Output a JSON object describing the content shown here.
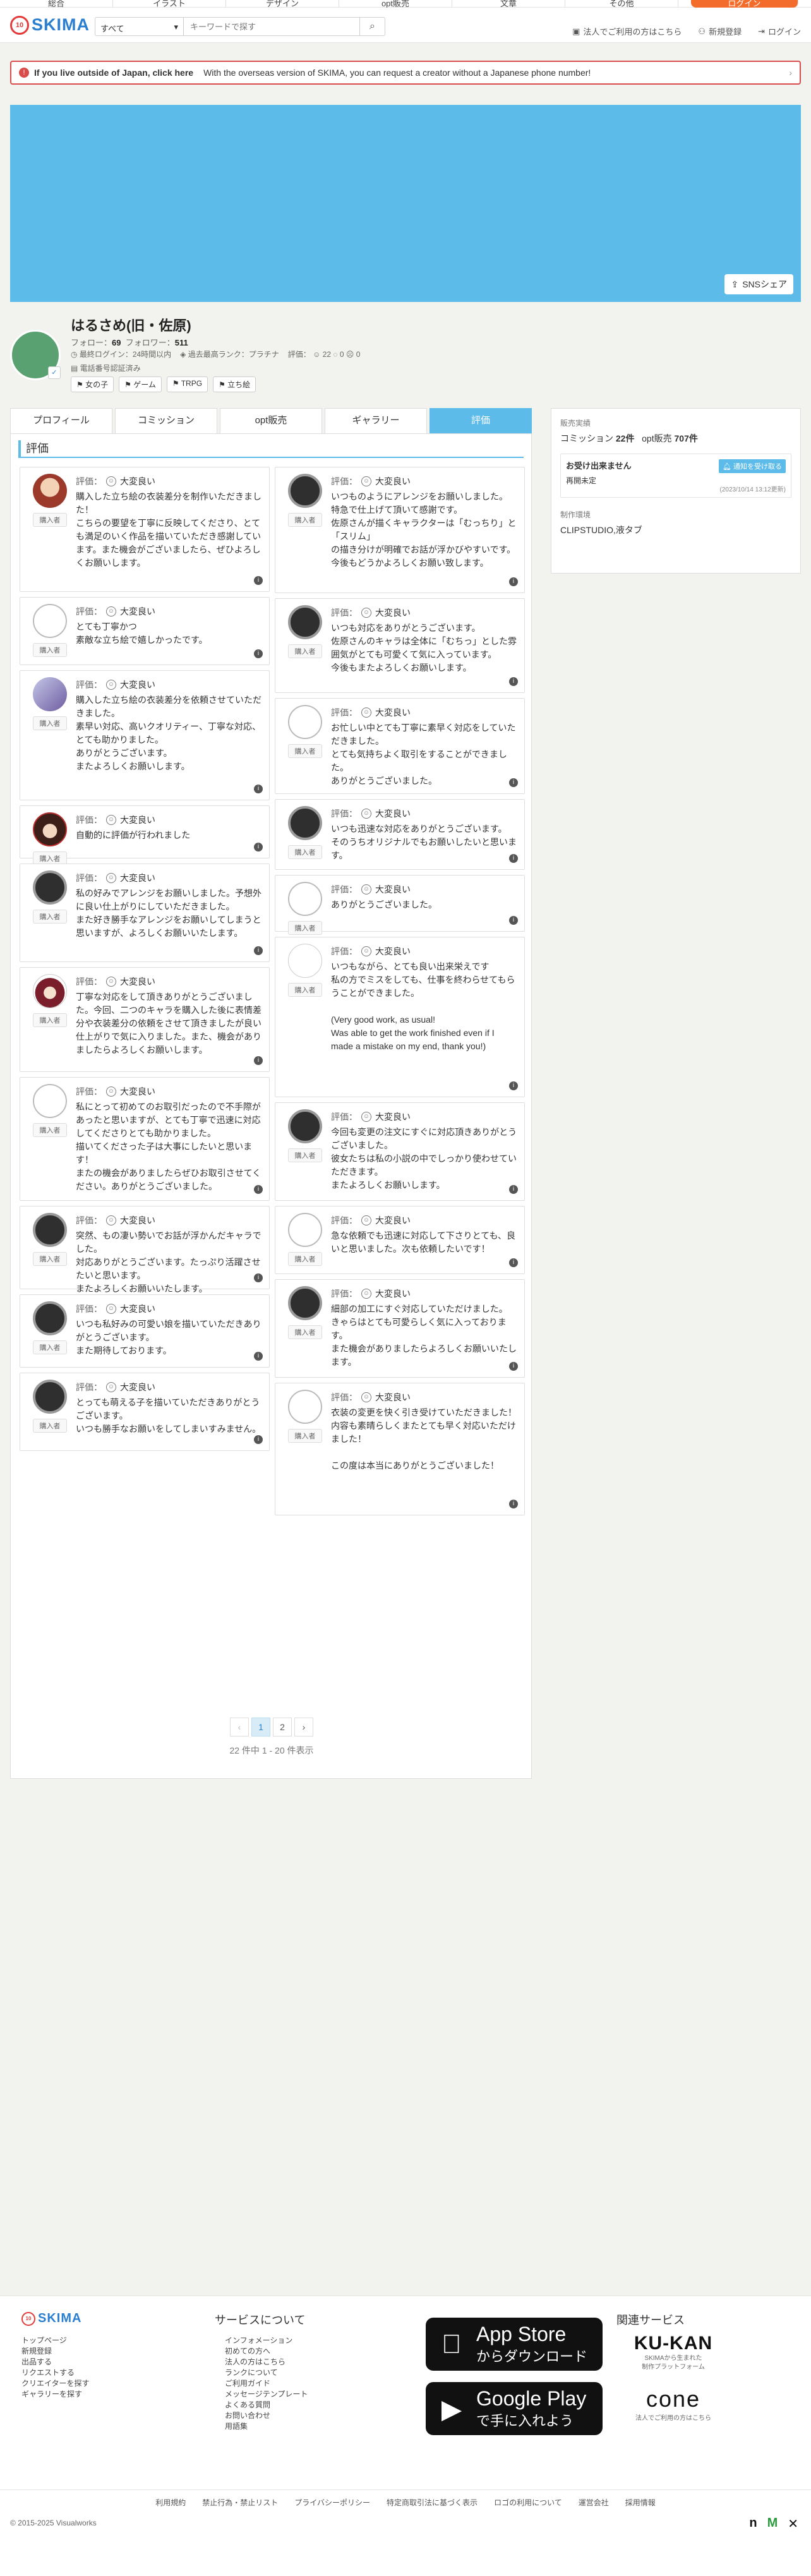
{
  "topnav": [
    "総合",
    "イラスト",
    "デザイン",
    "opt販売",
    "文章",
    "その他",
    "ログイン"
  ],
  "search": {
    "category": "すべて",
    "placeholder": "キーワードで探す"
  },
  "header_links": {
    "corporate": "法人でご利用の方はこちら",
    "register": "新規登録",
    "login": "ログイン"
  },
  "notice": {
    "bold": "If you live outside of Japan, click here",
    "text": "With the overseas version of SKIMA, you can request a creator without a Japanese phone number!"
  },
  "share_label": "SNSシェア",
  "profile": {
    "name": "はるさめ(旧・佐原)",
    "follow_label": "フォロー：",
    "follow": "69",
    "follower_label": "フォロワー：",
    "follower": "511",
    "last_login": "最終ログイン：24時間以内",
    "rank": "過去最高ランク：プラチナ",
    "ratings": "評価：",
    "rating_good": "22",
    "rating_mid": "0",
    "rating_bad": "0",
    "verified": "電話番号認証済み",
    "tags": [
      "女の子",
      "ゲーム",
      "TRPG",
      "立ち絵"
    ]
  },
  "tabs": [
    "プロフィール",
    "コミッション",
    "opt販売",
    "ギャラリー",
    "評価"
  ],
  "section_title": "評価",
  "rating_label": "評価：",
  "rating_value": "大変良い",
  "buyer_label": "購入者",
  "left_reviews": [
    "購入した立ち絵の衣装差分を制作いただきました！\nこちらの要望を丁寧に反映してくださり、とても満足のいく作品を描いていただき感謝しています。また機会がございましたら、ぜひよろしくお願いします。",
    "とても丁寧かつ\n素敵な立ち絵で嬉しかったです。",
    "購入した立ち絵の衣装差分を依頼させていただきました。\n素早い対応、高いクオリティー、丁寧な対応、とても助かりました。\nありがとうございます。\nまたよろしくお願いします。",
    "自動的に評価が行われました",
    "私の好みでアレンジをお願いしました。予想外に良い仕上がりにしていただきました。\nまた好き勝手なアレンジをお願いしてしまうと思いますが、よろしくお願いいたします。",
    "丁寧な対応をして頂きありがとうございました。今回、二つのキャラを購入した後に表情差分や衣装差分の依頼をさせて頂きましたが良い仕上がりで気に入りました。また、機会がありましたらよろしくお願いします。",
    "私にとって初めてのお取引だったので不手際があったと思いますが、とても丁寧で迅速に対応してくださりとても助かりました。\n描いてくださった子は大事にしたいと思います！\nまたの機会がありましたらぜひお取引させてください。ありがとうございました。",
    "突然、もの凄い勢いでお話が浮かんだキャラでした。\n対応ありがとうございます。たっぷり活躍させたいと思います。\nまたよろしくお願いいたします。",
    "いつも私好みの可愛い娘を描いていただきありがとうございます。\nまた期待しております。",
    "とっても萌える子を描いていただきありがとうございます。\nいつも勝手なお願いをしてしまいすみません。"
  ],
  "right_reviews": [
    "いつものようにアレンジをお願いしました。\n特急で仕上げて頂いて感謝です。\n佐原さんが描くキャラクターは「むっちり」と「スリム」\nの描き分けが明確でお話が浮かびやすいです。\n今後もどうかよろしくお願い致します。",
    "いつも対応をありがとうございます。\n佐原さんのキャラは全体に「むちっ」とした雰囲気がとても可愛くて気に入っています。\n今後もまたよろしくお願いします。",
    "お忙しい中とても丁寧に素早く対応をしていただきました。\nとても気持ちよく取引をすることができました。\nありがとうございました。",
    "いつも迅速な対応をありがとうございます。\nそのうちオリジナルでもお願いしたいと思います。",
    "ありがとうございました。",
    "いつもながら、とても良い出来栄えです\n私の方でミスをしても、仕事を終わらせてもらうことができました。\n\n(Very good work, as usual!\nWas able to get the work finished even if I made a mistake on my end, thank you!)",
    "今回も変更の注文にすぐに対応頂きありがとうございました。\n彼女たちは私の小説の中でしっかり使わせていただきます。\nまたよろしくお願いします。",
    "急な依頼でも迅速に対応して下さりとても、良いと思いました。次も依頼したいです！",
    "細部の加工にすぐ対応していただけました。\nきゃらはとても可愛らしく気に入っております。\nまた機会がありましたらよろしくお願いいたします。",
    "衣装の変更を快く引き受けていただきました！\n内容も素晴らしくまたとても早く対応いただけました！\n\nこの度は本当にありがとうございました！"
  ],
  "pager": {
    "prev": "‹",
    "pages": [
      "1",
      "2"
    ],
    "next": "›",
    "info": "22 件中 1 - 20 件表示"
  },
  "side": {
    "record_title": "販売実績",
    "commission_label": "コミッション",
    "commission_count": "22件",
    "opt_label": "opt販売",
    "opt_count": "707件",
    "status_title": "お受け出来ません",
    "notify_label": "通知を受け取る",
    "status_sub": "再開未定",
    "status_date": "(2023/10/14 13:12更新)",
    "env_title": "制作環境",
    "env_value": "CLIPSTUDIO,液タブ"
  },
  "footer": {
    "col1": [
      "トップページ",
      "新規登録",
      "出品する",
      "リクエストする",
      "クリエイターを探す",
      "ギャラリーを探す"
    ],
    "services_title": "サービスについて",
    "col2": [
      "インフォメーション",
      "初めての方へ",
      "法人の方はこちら",
      "ランクについて",
      "ご利用ガイド",
      "メッセージテンプレート",
      "よくある質問",
      "お問い合わせ",
      "用語集"
    ],
    "appstore_small": "App Store",
    "appstore_big": "からダウンロード",
    "googleplay_small": "Google Play",
    "googleplay_big": "で手に入れよう",
    "related_title": "関連サービス",
    "kukan": "KU-KAN",
    "kukan_sub": "SKIMAから生まれた\n制作プラットフォーム",
    "cone": "cone",
    "cone_sub": "法人でご利用の方はこちら",
    "links": [
      "利用規約",
      "禁止行為・禁止リスト",
      "プライバシーポリシー",
      "特定商取引法に基づく表示",
      "ロゴの利用について",
      "運営会社",
      "採用情報"
    ],
    "copyright": "© 2015-2025 Visualworks"
  }
}
